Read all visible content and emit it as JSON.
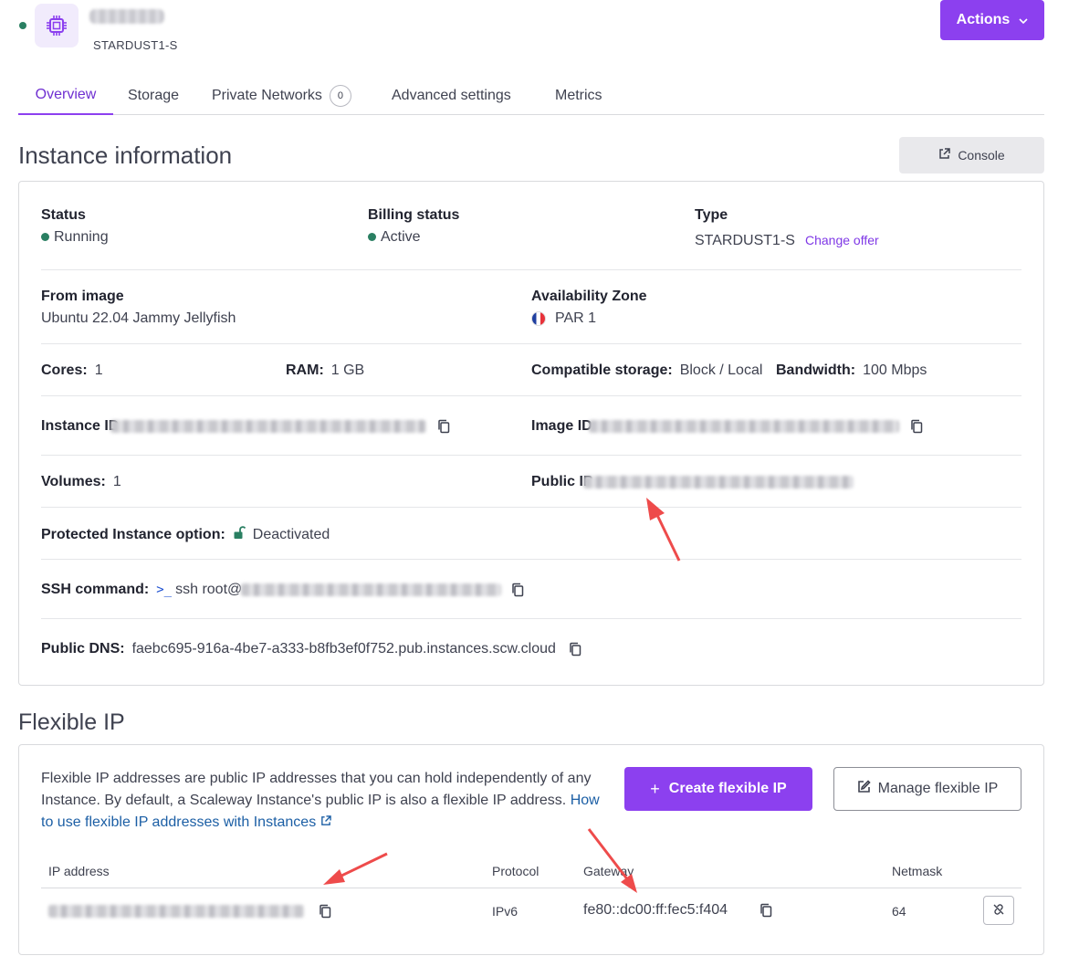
{
  "header": {
    "instance_type": "STARDUST1-S",
    "actions_label": "Actions"
  },
  "tabs": [
    {
      "label": "Overview"
    },
    {
      "label": "Storage"
    },
    {
      "label": "Private Networks",
      "count": "0"
    },
    {
      "label": "Advanced settings"
    },
    {
      "label": "Metrics"
    }
  ],
  "instance_info": {
    "title": "Instance information",
    "console_label": "Console",
    "status_label": "Status",
    "status_value": "Running",
    "billing_label": "Billing status",
    "billing_value": "Active",
    "type_label": "Type",
    "type_value": "STARDUST1-S",
    "change_offer": "Change offer",
    "image_label": "From image",
    "image_value": "Ubuntu 22.04 Jammy Jellyfish",
    "zone_label": "Availability Zone",
    "zone_value": "PAR 1",
    "cores_label": "Cores:",
    "cores_value": "1",
    "ram_label": "RAM:",
    "ram_value": "1 GB",
    "storage_label": "Compatible storage:",
    "storage_value": "Block / Local",
    "bandwidth_label": "Bandwidth:",
    "bandwidth_value": "100 Mbps",
    "instance_id_label": "Instance ID",
    "image_id_label": "Image ID",
    "volumes_label": "Volumes:",
    "volumes_value": "1",
    "public_ip_label": "Public IP",
    "protected_label": "Protected Instance option:",
    "protected_value": "Deactivated",
    "ssh_label": "SSH command:",
    "ssh_prompt": ">_",
    "ssh_value": "ssh root@",
    "dns_label": "Public DNS:",
    "dns_value": "faebc695-916a-4be7-a333-b8fb3ef0f752.pub.instances.scw.cloud"
  },
  "flexible_ip": {
    "title": "Flexible IP",
    "description": "Flexible IP addresses are public IP addresses that you can hold independently of any Instance. By default, a Scaleway Instance's public IP is also a flexible IP address.",
    "link_text": "How to use flexible IP addresses with Instances",
    "create_label": "Create flexible IP",
    "manage_label": "Manage flexible IP",
    "columns": [
      "IP address",
      "Protocol",
      "Gateway",
      "Netmask"
    ],
    "rows": [
      {
        "protocol": "IPv6",
        "gateway": "fe80::dc00:ff:fec5:f404",
        "netmask": "64"
      }
    ]
  },
  "colors": {
    "accent": "#8c40ef",
    "status_green": "#2a7f62",
    "annotation_red": "#ee4b4b"
  }
}
